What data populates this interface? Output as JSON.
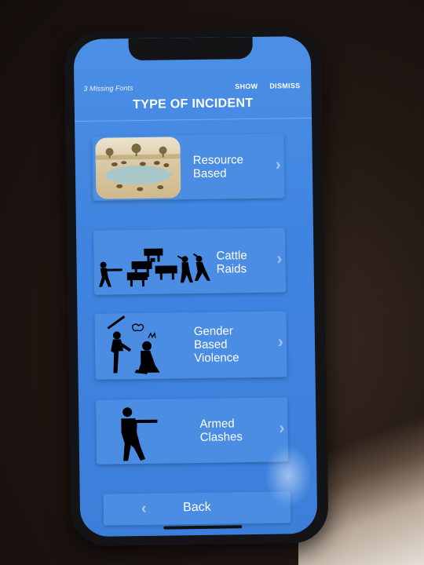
{
  "notice": {
    "message": "3 Missing Fonts",
    "show_label": "SHOW",
    "dismiss_label": "DISMISS"
  },
  "page": {
    "title": "TYPE OF INCIDENT"
  },
  "incidents": [
    {
      "line1": "Resource",
      "line2": "Based",
      "line3": "",
      "icon": "waterhole-photo"
    },
    {
      "line1": "Cattle",
      "line2": "Raids",
      "line3": "",
      "icon": "cattle-raid-icon"
    },
    {
      "line1": "Gender",
      "line2": "Based",
      "line3": "Violence",
      "icon": "gender-violence-icon"
    },
    {
      "line1": "Armed",
      "line2": "Clashes",
      "line3": "",
      "icon": "soldier-icon"
    }
  ],
  "footer": {
    "back_label": "Back"
  },
  "colors": {
    "screen_bg": "#3f84e0",
    "card_bg": "#4a8de3",
    "text": "#ffffff"
  }
}
